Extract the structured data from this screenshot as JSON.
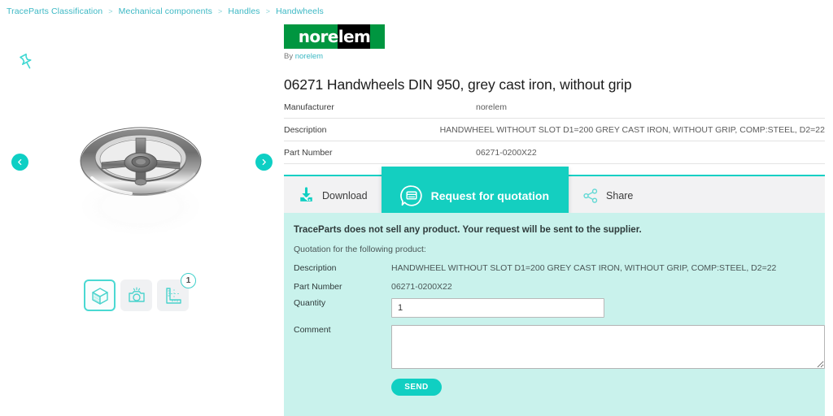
{
  "breadcrumb": {
    "items": [
      "TraceParts Classification",
      "Mechanical components",
      "Handles",
      "Handwheels"
    ],
    "separator": ">"
  },
  "viewer": {
    "pin_icon": "pin-icon",
    "prev_label": "Previous image",
    "next_label": "Next image",
    "model_alt": "3D handwheel model",
    "tools": [
      {
        "name": "3d-view",
        "icon": "cube-icon",
        "active": true,
        "badge": null
      },
      {
        "name": "photo-view",
        "icon": "camera-icon",
        "active": false,
        "badge": null
      },
      {
        "name": "drawing-view",
        "icon": "ruler-icon",
        "active": false,
        "badge": "1"
      }
    ]
  },
  "product": {
    "brand_logo_text": "norelem",
    "by_prefix": "By",
    "by_brand": "norelem",
    "title": "06271 Handwheels DIN 950, grey cast iron, without grip",
    "spec": [
      {
        "key": "Manufacturer",
        "value": "norelem"
      },
      {
        "key": "Description",
        "value": "HANDWHEEL WITHOUT SLOT D1=200 GREY CAST IRON, WITHOUT GRIP, COMP:STEEL, D2=22"
      },
      {
        "key": "Part Number",
        "value": "06271-0200X22"
      }
    ]
  },
  "tabs": [
    {
      "label": "Download",
      "icon": "download-icon",
      "active": false
    },
    {
      "label": "Request for quotation",
      "icon": "quote-bubble-icon",
      "active": true
    },
    {
      "label": "Share",
      "icon": "share-nodes-icon",
      "active": false
    }
  ],
  "quotation": {
    "notice": "TraceParts does not sell any product. Your request will be sent to the supplier.",
    "subtitle": "Quotation for the following product:",
    "description_label": "Description",
    "description_value": "HANDWHEEL WITHOUT SLOT D1=200 GREY CAST IRON, WITHOUT GRIP, COMP:STEEL, D2=22",
    "part_number_label": "Part Number",
    "part_number_value": "06271-0200X22",
    "quantity_label": "Quantity",
    "quantity_value": "1",
    "quantity_placeholder": "",
    "comment_label": "Comment",
    "comment_value": "",
    "comment_placeholder": "",
    "send_label": "SEND"
  },
  "colors": {
    "accent_teal": "#0ecfc4",
    "tab_active": "#14cfc0",
    "form_bg": "#c9f2ec",
    "brand_green": "#009640",
    "link": "#3cb8c4"
  }
}
